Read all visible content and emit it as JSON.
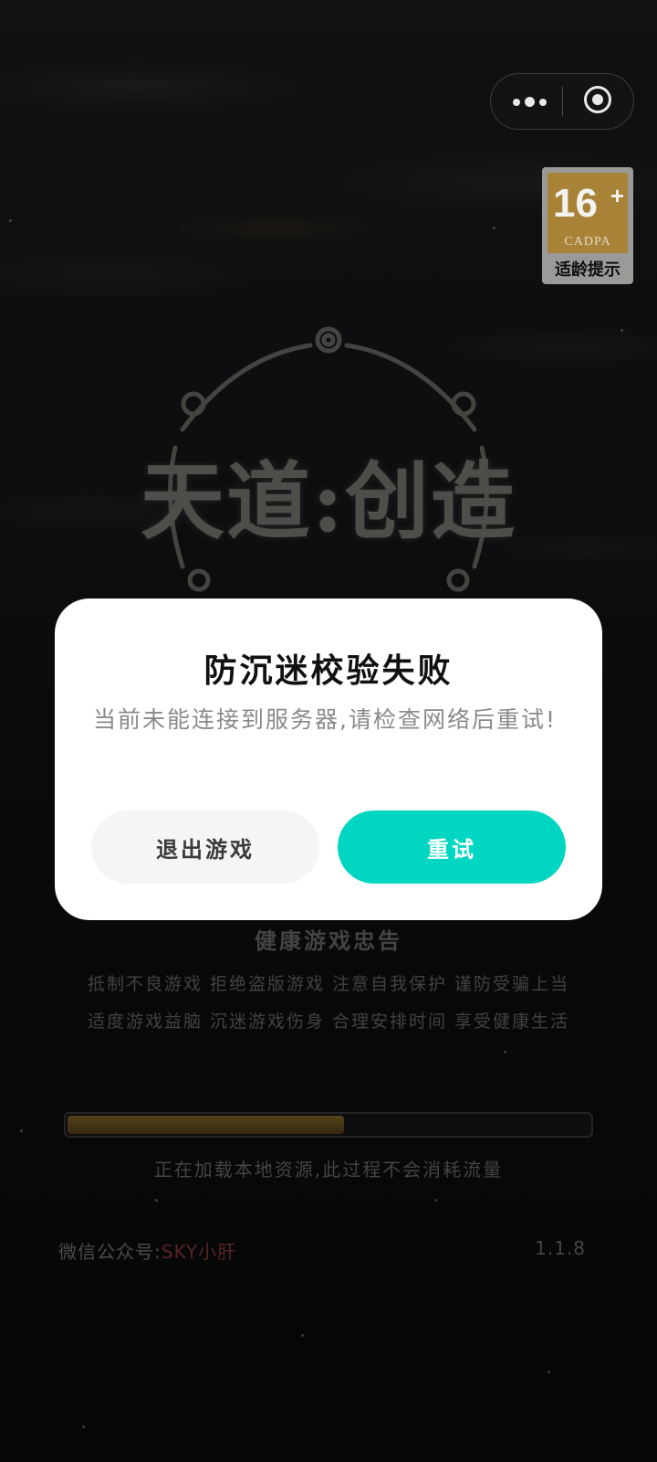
{
  "capsule": {
    "more_icon": "more-dots-icon",
    "close_icon": "close-target-icon"
  },
  "age_badge": {
    "rating": "16",
    "plus": "+",
    "org": "CADPA",
    "label": "适龄提示",
    "plate_color": "#a88337"
  },
  "logo": {
    "title": "天道:创造"
  },
  "dialog": {
    "title": "防沉迷校验失败",
    "message": "当前未能连接到服务器,请检查网络后重试!",
    "exit_label": "退出游戏",
    "retry_label": "重试",
    "retry_color": "#00d6c2"
  },
  "health_notice": {
    "title": "健康游戏忠告",
    "line1": "抵制不良游戏 拒绝盗版游戏 注意自我保护 谨防受骗上当",
    "line2": "适度游戏益脑 沉迷游戏伤身 合理安排时间 享受健康生活"
  },
  "loading": {
    "progress": 0.53,
    "text": "正在加载本地资源,此过程不会消耗流量"
  },
  "footer": {
    "wechat_label": "微信公众号:",
    "wechat_account": "SKY小肝",
    "version": "1.1.8"
  }
}
